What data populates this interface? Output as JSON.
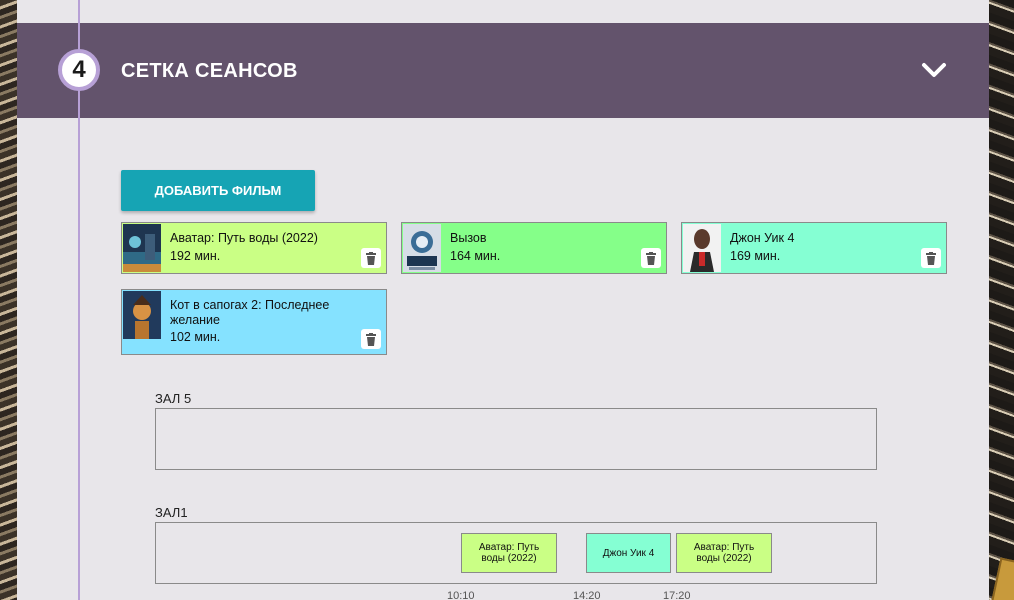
{
  "header": {
    "step_number": "4",
    "title": "СЕТКА СЕАНСОВ"
  },
  "add_button_label": "ДОБАВИТЬ ФИЛЬМ",
  "movies": [
    {
      "title": "Аватар: Путь воды (2022)",
      "duration": "192 мин.",
      "color": "#caff85"
    },
    {
      "title": "Вызов",
      "duration": "164 мин.",
      "color": "#85ff89"
    },
    {
      "title": "Джон Уик 4",
      "duration": "169 мин.",
      "color": "#85ffd3"
    },
    {
      "title": "Кот в сапогах 2: Последнее желание",
      "duration": "102 мин.",
      "color": "#85e2ff"
    }
  ],
  "halls": [
    {
      "name": "ЗАЛ 5",
      "sessions": []
    },
    {
      "name": "ЗАЛ1",
      "sessions": [
        {
          "title": "Аватар: Путь воды (2022)",
          "start": "10:10",
          "color": "#caff85"
        },
        {
          "title": "Джон Уик 4",
          "start": "14:20",
          "color": "#85ffd3"
        },
        {
          "title": "Аватар: Путь воды (2022)",
          "start": "17:20",
          "color": "#caff85"
        }
      ]
    }
  ],
  "colors": {
    "header_bg": "#63536c",
    "accent": "#16a4b4",
    "timeline": "#b7a0d6"
  },
  "icons": {
    "chevron": "chevron-down-icon",
    "trash": "trash-icon"
  }
}
